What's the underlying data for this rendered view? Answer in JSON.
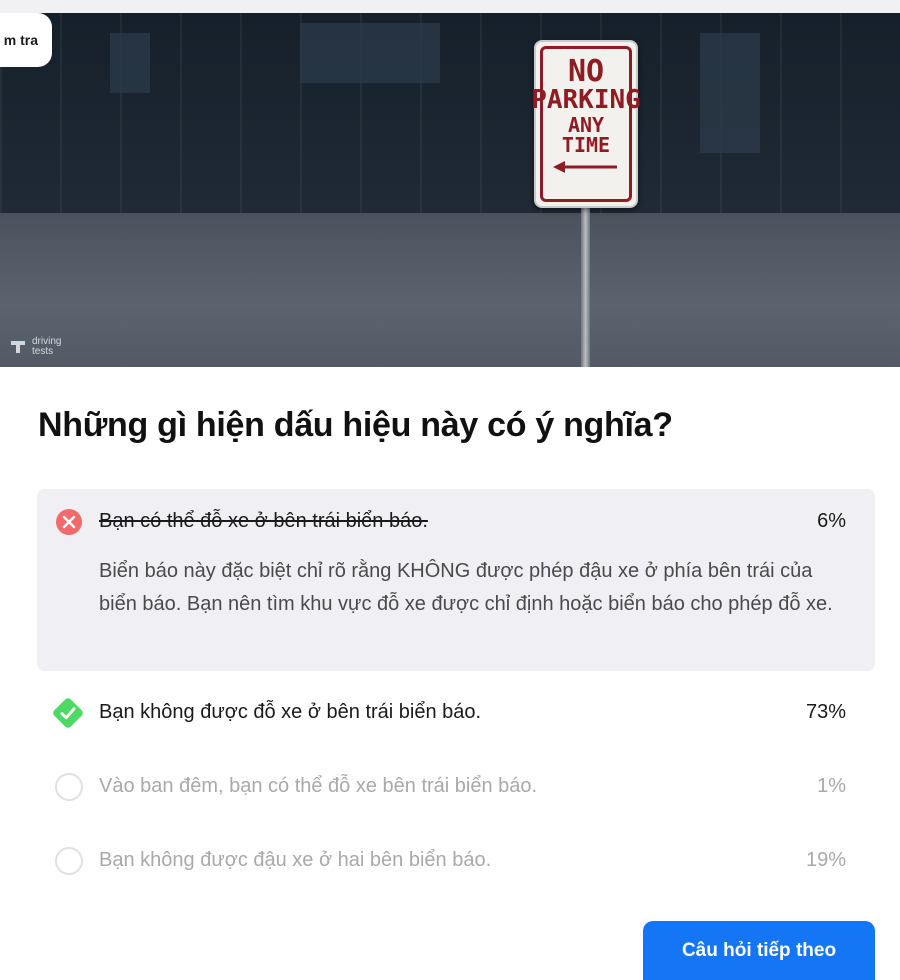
{
  "hero": {
    "tab_label": "m tra",
    "sign": {
      "line1": "NO",
      "line2": "PARKING",
      "line3": "ANY",
      "line4": "TIME"
    },
    "watermark": "driving tests"
  },
  "question": {
    "text": "Những gì hiện dấu hiệu này có ý nghĩa?"
  },
  "answers": [
    {
      "text": "Bạn có thể đỗ xe ở bên trái biển báo.",
      "percent": "6%",
      "state": "wrong",
      "explanation": "Biển báo này đặc biệt chỉ rõ rằng KHÔNG được phép đậu xe ở phía bên trái của biển báo. Bạn nên tìm khu vực đỗ xe được chỉ định hoặc biển báo cho phép đỗ xe."
    },
    {
      "text": "Bạn không được đỗ xe ở bên trái biển báo.",
      "percent": "73%",
      "state": "correct"
    },
    {
      "text": "Vào ban đêm, bạn có thể đỗ xe bên trái biển báo.",
      "percent": "1%",
      "state": "unselected"
    },
    {
      "text": "Bạn không được đậu xe ở hai bên biển báo.",
      "percent": "19%",
      "state": "unselected"
    }
  ],
  "next_button": {
    "label": "Câu hỏi tiếp theo"
  },
  "colors": {
    "wrong": "#f06b6b",
    "correct": "#4cd964",
    "primary": "#1476f5",
    "wrong_bg": "#f0f0f4"
  }
}
